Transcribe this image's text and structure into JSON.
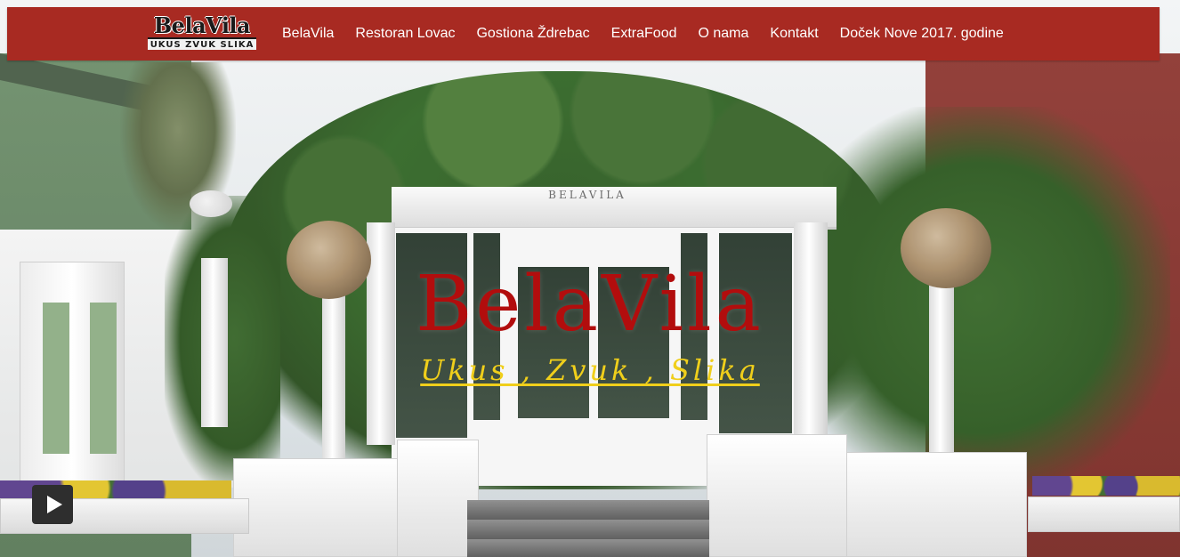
{
  "brand": {
    "logo_main": "BelaVila",
    "logo_sub": "UKUS ZVUK SLIKA"
  },
  "nav": {
    "items": [
      {
        "label": "BelaVila"
      },
      {
        "label": "Restoran Lovac"
      },
      {
        "label": "Gostiona Ždrebac"
      },
      {
        "label": "ExtraFood"
      },
      {
        "label": "O nama"
      },
      {
        "label": "Kontakt"
      },
      {
        "label": "Doček Nove 2017. godine"
      }
    ]
  },
  "hero": {
    "title": "BelaVila",
    "subtitle": "Ukus , Zvuk , Slika",
    "building_sign": "BELAVILA",
    "image_description": "White entrance portico of the BelaVila building covered in green ivy, with globe lamps on white pedestals"
  },
  "controls": {
    "play_icon": "play-icon"
  },
  "colors": {
    "navbar_bg": "#a82a22",
    "nav_text": "#ffffff",
    "title_color": "#b20d0d",
    "subtitle_color": "#f0cf1b",
    "play_button_bg": "#2e2e2e"
  }
}
